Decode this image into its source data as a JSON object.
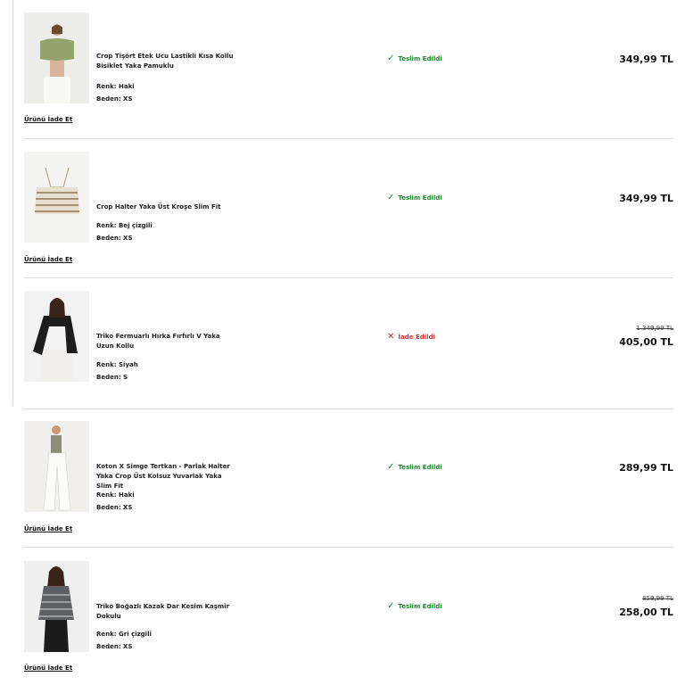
{
  "return_link_label": "Ürünü İade Et",
  "colors": {
    "delivered": "#1a8a2a",
    "returned": "#d32f2f"
  },
  "items": [
    {
      "title": "Crop Tişört Etek Ucu Lastikli Kısa Kollu Bisiklet Yaka Pamuklu",
      "color_line": "Renk: Haki",
      "size_line": "Beden: XS",
      "status": "Teslim Edildi",
      "status_icon": "check-icon",
      "old_price": "",
      "price": "349,99 TL"
    },
    {
      "title": "Crop Halter Yaka Üst Kroşe Slim Fit",
      "color_line": "Renk: Bej çizgili",
      "size_line": "Beden: XS",
      "status": "Teslim Edildi",
      "status_icon": "check-icon",
      "old_price": "",
      "price": "349,99 TL"
    },
    {
      "title": "Triko Fermuarlı Hırka Fırfırlı V Yaka Uzun Kollu",
      "color_line": "Renk: Siyah",
      "size_line": "Beden: S",
      "status": "İade Edildi",
      "status_icon": "cross-icon",
      "old_price": "1.349,99 TL",
      "price": "405,00 TL"
    },
    {
      "title": "Koton X Simge Tertkan - Parlak Halter Yaka Crop Üst Kolsuz Yuvarlak Yaka Slim Fit",
      "color_line": "Renk: Haki",
      "size_line": "Beden: XS",
      "status": "Teslim Edildi",
      "status_icon": "check-icon",
      "old_price": "",
      "price": "289,99 TL"
    },
    {
      "title": "Triko Boğazlı Kazak Dar Kesim Kaşmir Dokulu",
      "color_line": "Renk: Gri çizgili",
      "size_line": "Beden: XS",
      "status": "Teslim Edildi",
      "status_icon": "check-icon",
      "old_price": "859,99 TL",
      "price": "258,00 TL"
    }
  ]
}
